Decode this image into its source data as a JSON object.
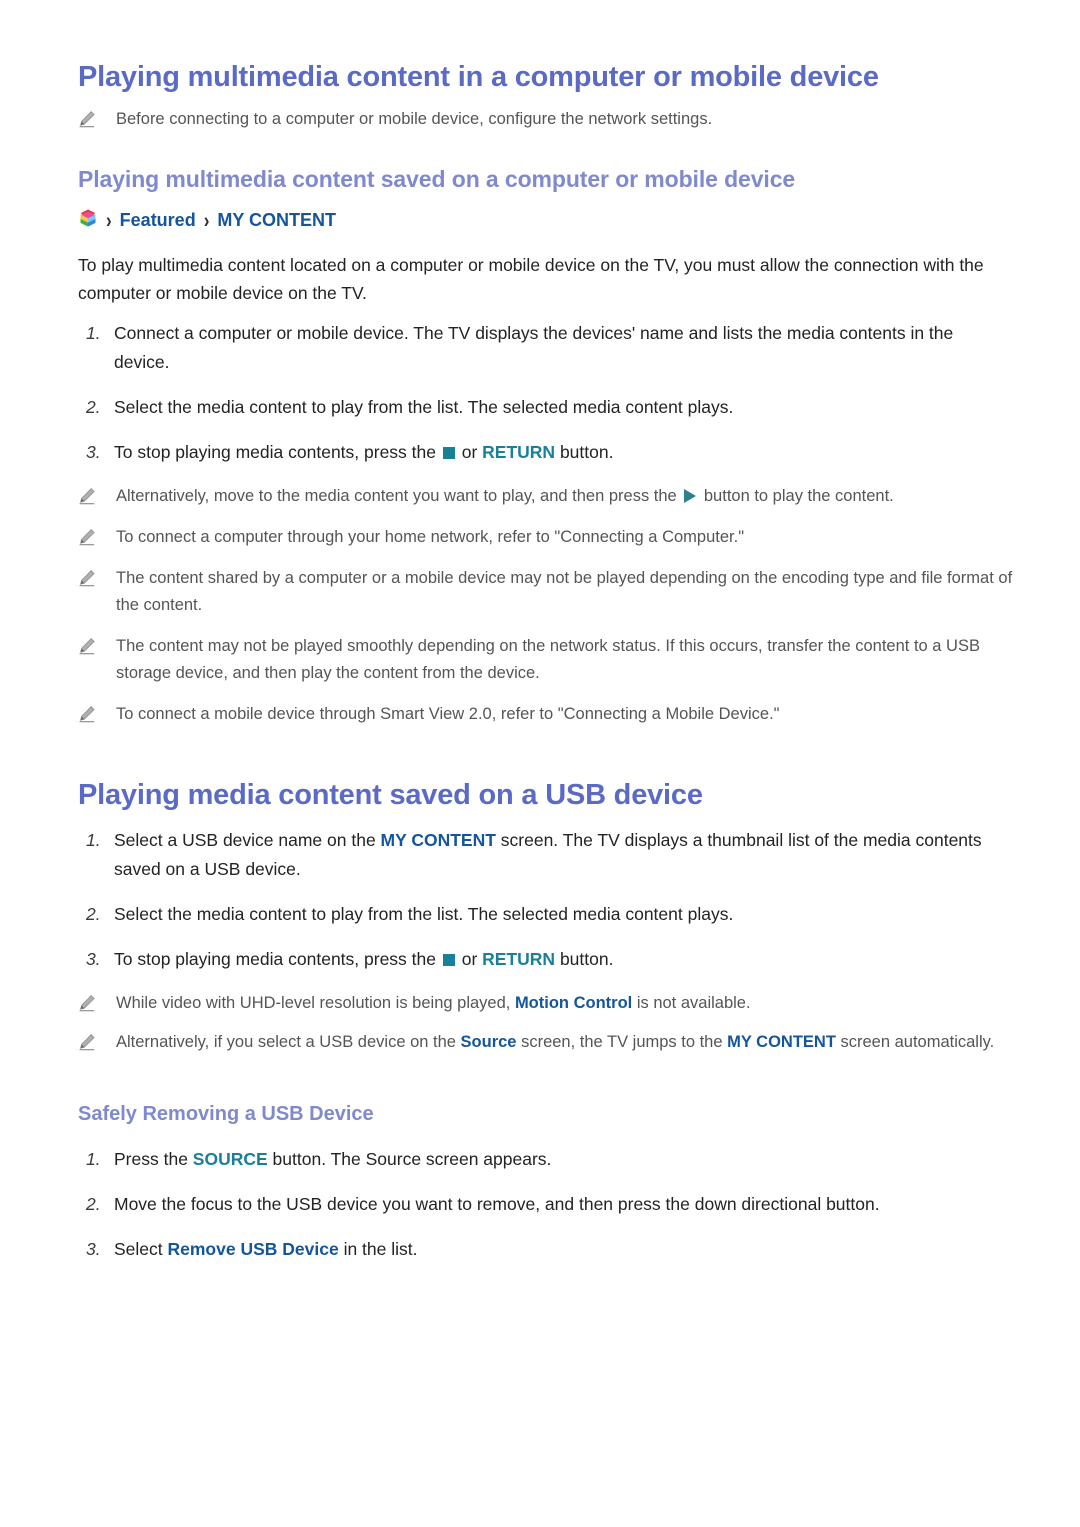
{
  "document": {
    "sections": [
      {
        "id": "multimedia-computer-mobile",
        "heading": "Playing multimedia content in a computer or mobile device",
        "intro_note": "Before connecting to a computer or mobile device, configure the network settings."
      },
      {
        "id": "saved-on-computer-mobile",
        "heading": "Playing multimedia content saved on a computer or mobile device"
      },
      {
        "id": "usb-device",
        "heading": "Playing media content saved on a USB device"
      },
      {
        "id": "safely-removing",
        "heading": "Safely Removing a USB Device"
      }
    ]
  },
  "breadcrumb": {
    "icon": "smart-hub-cube-icon",
    "separator": "›",
    "items": [
      "Featured",
      "MY CONTENT"
    ]
  },
  "intro_paragraph": "To play multimedia content located on a computer or mobile device on the TV, you must allow the connection with the computer or mobile device on the TV.",
  "steps_computer": [
    {
      "num": "1.",
      "parts": [
        {
          "type": "text",
          "value": "Connect a computer or mobile device. The TV displays the devices' name and lists the media contents in the device."
        }
      ]
    },
    {
      "num": "2.",
      "parts": [
        {
          "type": "text",
          "value": "Select the media content to play from the list. The selected media content plays."
        }
      ]
    },
    {
      "num": "3.",
      "parts": [
        {
          "type": "text",
          "value": "To stop playing media contents, press the "
        },
        {
          "type": "glyph",
          "value": "stop-button-glyph"
        },
        {
          "type": "text",
          "value": " or "
        },
        {
          "type": "key-teal",
          "value": "RETURN"
        },
        {
          "type": "text",
          "value": " button."
        }
      ]
    }
  ],
  "notes_computer": [
    {
      "parts": [
        {
          "type": "text",
          "value": "Alternatively, move to the media content you want to play, and then press the "
        },
        {
          "type": "glyph",
          "value": "play-button-glyph"
        },
        {
          "type": "text",
          "value": " button to play the content."
        }
      ]
    },
    {
      "parts": [
        {
          "type": "text",
          "value": "To connect a computer through your home network, refer to \"Connecting a Computer.\""
        }
      ]
    },
    {
      "parts": [
        {
          "type": "text",
          "value": "The content shared by a computer or a mobile device may not be played depending on the encoding type and file format of the content."
        }
      ]
    },
    {
      "parts": [
        {
          "type": "text",
          "value": "The content may not be played smoothly depending on the network status. If this occurs, transfer the content to a USB storage device, and then play the content from the device."
        }
      ]
    },
    {
      "parts": [
        {
          "type": "text",
          "value": "To connect a mobile device through Smart View 2.0, refer to \"Connecting a Mobile Device.\""
        }
      ]
    }
  ],
  "steps_usb": [
    {
      "num": "1.",
      "parts": [
        {
          "type": "text",
          "value": "Select a USB device name on the "
        },
        {
          "type": "key-blue",
          "value": "MY CONTENT"
        },
        {
          "type": "text",
          "value": " screen. The TV displays a thumbnail list of the media contents saved on a USB device."
        }
      ]
    },
    {
      "num": "2.",
      "parts": [
        {
          "type": "text",
          "value": "Select the media content to play from the list. The selected media content plays."
        }
      ]
    },
    {
      "num": "3.",
      "parts": [
        {
          "type": "text",
          "value": "To stop playing media contents, press the "
        },
        {
          "type": "glyph",
          "value": "stop-button-glyph"
        },
        {
          "type": "text",
          "value": " or "
        },
        {
          "type": "key-teal",
          "value": "RETURN"
        },
        {
          "type": "text",
          "value": " button."
        }
      ]
    }
  ],
  "notes_usb": [
    {
      "parts": [
        {
          "type": "text",
          "value": "While video with UHD-level resolution is being played, "
        },
        {
          "type": "key-blue",
          "value": "Motion Control"
        },
        {
          "type": "text",
          "value": " is not available."
        }
      ]
    },
    {
      "parts": [
        {
          "type": "text",
          "value": "Alternatively, if you select a USB device on the "
        },
        {
          "type": "key-blue",
          "value": "Source"
        },
        {
          "type": "text",
          "value": " screen, the TV jumps to the "
        },
        {
          "type": "key-blue",
          "value": "MY CONTENT"
        },
        {
          "type": "text",
          "value": " screen automatically."
        }
      ]
    }
  ],
  "steps_removing": [
    {
      "num": "1.",
      "parts": [
        {
          "type": "text",
          "value": "Press the "
        },
        {
          "type": "key-teal",
          "value": "SOURCE"
        },
        {
          "type": "text",
          "value": " button. The Source screen appears."
        }
      ]
    },
    {
      "num": "2.",
      "parts": [
        {
          "type": "text",
          "value": "Move the focus to the USB device you want to remove, and then press the down directional button."
        }
      ]
    },
    {
      "num": "3.",
      "parts": [
        {
          "type": "text",
          "value": "Select "
        },
        {
          "type": "key-blue",
          "value": "Remove USB Device"
        },
        {
          "type": "text",
          "value": " in the list."
        }
      ]
    }
  ],
  "colors": {
    "heading_major": "#5b6ac4",
    "heading_sub": "#8089ce",
    "key_teal": "#1a7f98",
    "key_blue": "#15559a",
    "body_text": "#232323",
    "note_text": "#555555",
    "note_icon": "#9a9a9a"
  }
}
